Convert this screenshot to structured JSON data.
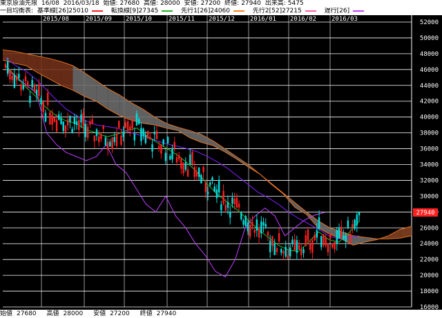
{
  "header": {
    "symbol": "東京原油先限",
    "contract": "16/08",
    "date": "2016/03/18",
    "open_label": "始値:",
    "open": "27680",
    "high_label": "高値:",
    "high": "28000",
    "low_label": "安値:",
    "low": "27200",
    "close_label": "終値:",
    "close": "27940",
    "volume_label": "出来高:",
    "volume": "5475"
  },
  "legend": {
    "title": "一目均衡表:",
    "items": [
      {
        "label": "基準線[26]25010",
        "color": "#ff2020"
      },
      {
        "label": "転換線[9]27345",
        "color": "#20ff20"
      },
      {
        "label": "先行1[26]24060",
        "color": "#ff8020"
      },
      {
        "label": "先行2[52]27215",
        "color": "#ff60a0"
      },
      {
        "label": "遅行[26]",
        "color": "#c040ff"
      }
    ]
  },
  "price_tag": "27940",
  "footer": {
    "open_label": "始値",
    "open": "27680",
    "high_label": "高値",
    "high": "28000",
    "low_label": "安値",
    "low": "27200",
    "close_label": "終値",
    "close": "27940"
  },
  "colors": {
    "up": "#ff2020",
    "down": "#00e0e0",
    "kijun": "#ff2020",
    "tenkan": "#20ff20",
    "senkou1": "#e07020",
    "senkou2": "#e07020",
    "chikou": "#c040ff",
    "cloud_bear": "#803020",
    "cloud_bull": "#606060"
  },
  "chart_data": {
    "type": "line",
    "ylim": [
      16000,
      52000
    ],
    "y_ticks": [
      "52000",
      "50000",
      "48000",
      "46000",
      "44000",
      "42000",
      "40000",
      "38000",
      "36000",
      "34000",
      "32000",
      "30000",
      "28000",
      "26000",
      "24000",
      "22000",
      "20000",
      "18000",
      "16000"
    ],
    "x_labels": [
      "2015/08",
      "2015/09",
      "2015/10",
      "2015/11",
      "2015/12",
      "2016/01",
      "2016/02",
      "2016/03"
    ],
    "series": [
      {
        "name": "基準線[26]",
        "values": [
          47500,
          46500,
          45800,
          44800,
          43500,
          42200,
          41000,
          40200,
          39500,
          39000,
          38800,
          38600,
          38200,
          37800,
          37500,
          37000,
          36600,
          36300,
          36000,
          35600,
          35000,
          34300,
          33500,
          32500,
          31500,
          30500,
          29800,
          29000,
          28000,
          27200,
          26500,
          25800,
          25000,
          24600,
          24800,
          25000
        ]
      },
      {
        "name": "転換線[9]",
        "values": [
          46500,
          45200,
          43800,
          42600,
          41200,
          40200,
          39500,
          39200,
          38400,
          38000,
          37500,
          37800,
          38300,
          38600,
          37600,
          36800,
          36000,
          35200,
          34200,
          33000,
          31500,
          30200,
          29200,
          28200,
          27000,
          25800,
          24800,
          23800,
          23200,
          23000,
          24200,
          25500,
          24500,
          24200,
          25400,
          26800
        ]
      },
      {
        "name": "先行1[26]",
        "values": [
          47200,
          46800,
          46500,
          45600,
          44800,
          44000,
          43400,
          42600,
          42000,
          41000,
          40200,
          39600,
          39200,
          39000,
          38600,
          38300,
          37400,
          36800,
          36400,
          35600,
          34700,
          33700,
          32800,
          31500,
          30300,
          28600,
          27700,
          26000,
          25200,
          24600,
          23800,
          24200,
          24500,
          25000,
          25800,
          26200
        ]
      },
      {
        "name": "先行2[52]",
        "values": [
          48500,
          48300,
          48000,
          47700,
          47400,
          47000,
          46500,
          45600,
          44600,
          43600,
          42800,
          41800,
          41000,
          40000,
          39200,
          38700,
          38300,
          37800,
          37000,
          36000,
          35000,
          34000,
          32800,
          31600,
          30400,
          29200,
          28000,
          26900,
          26000,
          25500,
          25000,
          24800,
          24600,
          24600,
          24700,
          25000
        ]
      },
      {
        "name": "遅行[26]",
        "values": [
          46000,
          45000,
          44000,
          43000,
          38000,
          36500,
          35500,
          35000,
          34500,
          35000,
          36500,
          34000,
          33000,
          31000,
          29000,
          28000,
          30000,
          27500,
          26000,
          24000,
          22500,
          20500,
          19800,
          22000,
          26000,
          27500,
          28500,
          27500,
          25000,
          26000,
          27000,
          27600,
          27940
        ]
      },
      {
        "name": "candles",
        "values": []
      }
    ]
  }
}
